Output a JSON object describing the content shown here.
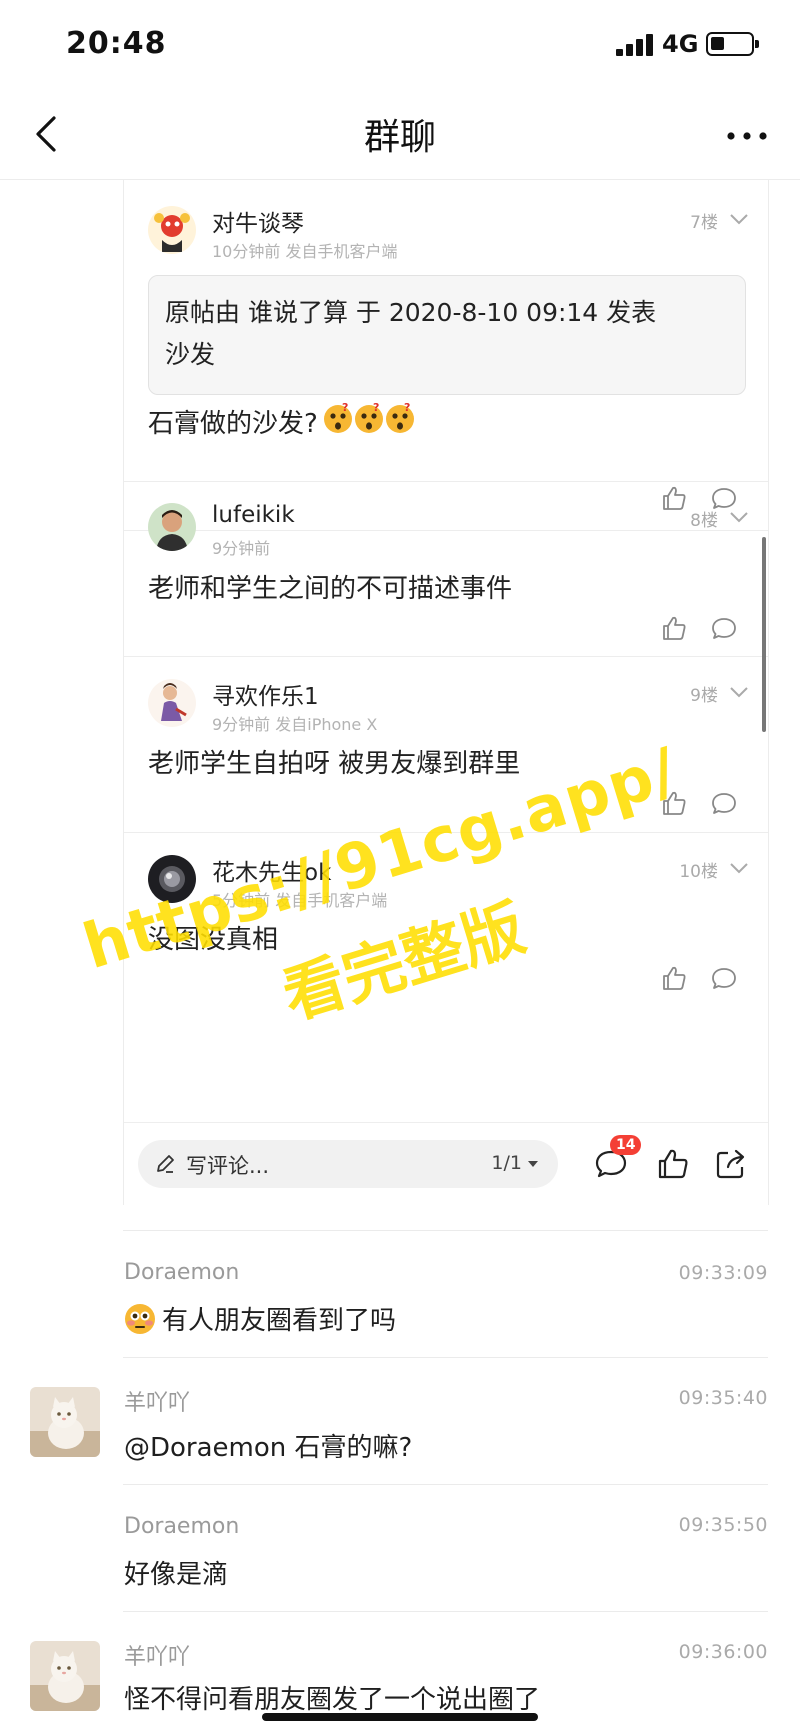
{
  "status_bar": {
    "time": "20:48",
    "network": "4G"
  },
  "nav": {
    "title": "群聊"
  },
  "posts": [
    {
      "author": "对牛谈琴",
      "meta": "10分钟前 发自手机客户端",
      "floor": "7楼",
      "quote": "原帖由 谁说了算 于 2020-8-10 09:14 发表",
      "quote_line2": "沙发",
      "body": "石膏做的沙发?"
    },
    {
      "author": "lufeikik",
      "meta": "9分钟前",
      "floor": "8楼",
      "body": "老师和学生之间的不可描述事件"
    },
    {
      "author": "寻欢作乐1",
      "meta": "9分钟前 发自iPhone X",
      "floor": "9楼",
      "body": "老师学生自拍呀 被男友爆到群里"
    },
    {
      "author": "花木先生ok",
      "meta": "5分钟前 发自手机客户端",
      "floor": "10楼",
      "body": "没图没真相"
    }
  ],
  "comment_bar": {
    "placeholder": "写评论...",
    "page": "1/1",
    "comment_count": "14"
  },
  "watermark": {
    "line1": "https://91cg.app/",
    "line2": "看完整版"
  },
  "messages": [
    {
      "sender": "Doraemon",
      "time": "09:33:09",
      "text": "有人朋友圈看到了吗",
      "emoji": "flushed-face"
    },
    {
      "sender": "羊吖吖",
      "time": "09:35:40",
      "text": "@Doraemon 石膏的嘛?"
    },
    {
      "sender": "Doraemon",
      "time": "09:35:50",
      "text": "好像是滴"
    },
    {
      "sender": "羊吖吖",
      "time": "09:36:00",
      "text": "怪不得问看朋友圈发了一个说出圈了"
    }
  ],
  "colors": {
    "badge": "#f43f35",
    "watermark": "#ffde00",
    "meta_gray": "#b3b3b3",
    "emoji_yellow": "#f7b733"
  }
}
